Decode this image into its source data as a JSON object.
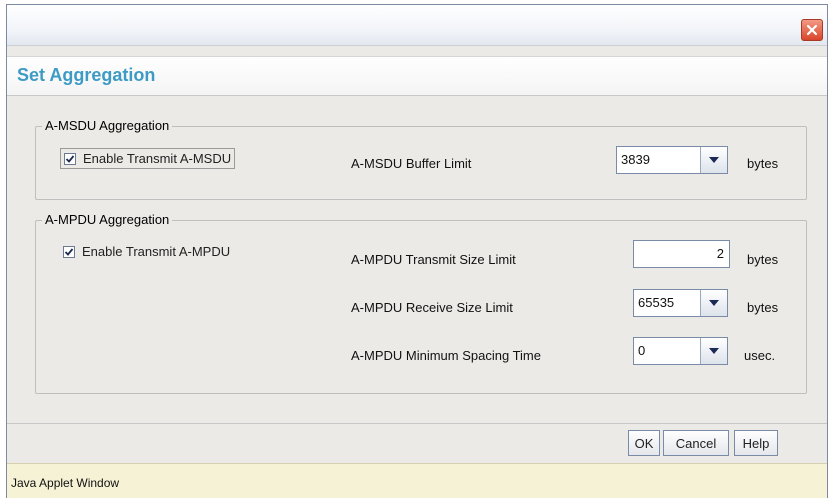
{
  "window": {
    "close_icon": "close-icon",
    "dialog_title": "Set Aggregation"
  },
  "amsdu": {
    "group_title": "A-MSDU Aggregation",
    "enable_label": "Enable Transmit A-MSDU",
    "enable_checked": true,
    "buffer_limit_label": "A-MSDU Buffer Limit",
    "buffer_limit_value": "3839",
    "buffer_limit_unit": "bytes"
  },
  "ampdu": {
    "group_title": "A-MPDU Aggregation",
    "enable_label": "Enable Transmit A-MPDU",
    "enable_checked": true,
    "transmit_size_label": "A-MPDU Transmit Size Limit",
    "transmit_size_value": "2",
    "transmit_size_unit": "bytes",
    "receive_size_label": "A-MPDU Receive Size Limit",
    "receive_size_value": "65535",
    "receive_size_unit": "bytes",
    "min_spacing_label": "A-MPDU Minimum Spacing Time",
    "min_spacing_value": "0",
    "min_spacing_unit": "usec."
  },
  "buttons": {
    "ok": "OK",
    "cancel": "Cancel",
    "help": "Help"
  },
  "status": {
    "text": "Java Applet Window"
  },
  "colors": {
    "title": "#3d9bc6",
    "close": "#d8452b",
    "status_bg": "#f6f2d6"
  }
}
